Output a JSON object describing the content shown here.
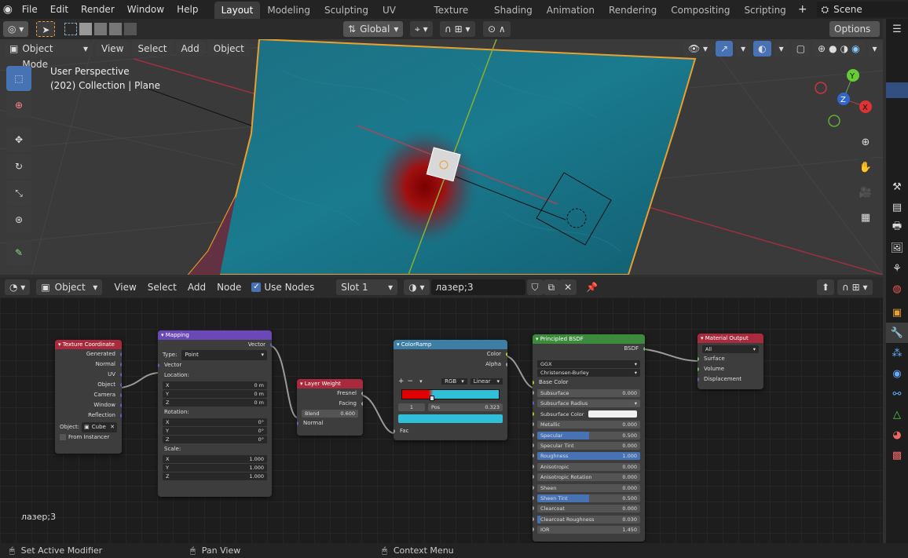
{
  "menubar": {
    "items": [
      "File",
      "Edit",
      "Render",
      "Window",
      "Help"
    ],
    "tabs": [
      "Layout",
      "Modeling",
      "Sculpting",
      "UV Editing",
      "Texture Paint",
      "Shading",
      "Animation",
      "Rendering",
      "Compositing",
      "Scripting"
    ],
    "active_tab": "Layout",
    "scene": "Scene"
  },
  "viewport": {
    "transform": "Global",
    "options": "Options",
    "mode": "Object Mode",
    "menus": [
      "View",
      "Select",
      "Add",
      "Object"
    ],
    "overlay_line1": "User Perspective",
    "overlay_line2": "(202) Collection | Plane",
    "gizmo": {
      "x": "X",
      "y": "Y",
      "z": "Z"
    }
  },
  "node_editor": {
    "type": "Object",
    "menus": [
      "View",
      "Select",
      "Add",
      "Node"
    ],
    "use_nodes": "Use Nodes",
    "slot": "Slot 1",
    "material": "лазер;3",
    "corner_label": "лазер;3"
  },
  "nodes": {
    "tex_coord": {
      "title": "Texture Coordinate",
      "outputs": [
        "Generated",
        "Normal",
        "UV",
        "Object",
        "Camera",
        "Window",
        "Reflection"
      ],
      "object_label": "Object:",
      "object_value": "Cube",
      "from_instancer": "From Instancer"
    },
    "mapping": {
      "title": "Mapping",
      "out": "Vector",
      "type_label": "Type:",
      "type_value": "Point",
      "in_vector": "Vector",
      "location": "Location:",
      "loc": [
        [
          "X",
          "0 m"
        ],
        [
          "Y",
          "0 m"
        ],
        [
          "Z",
          "0 m"
        ]
      ],
      "rotation": "Rotation:",
      "rot": [
        [
          "X",
          "0°"
        ],
        [
          "Y",
          "0°"
        ],
        [
          "Z",
          "0°"
        ]
      ],
      "scale": "Scale:",
      "scl": [
        [
          "X",
          "1.000"
        ],
        [
          "Y",
          "1.000"
        ],
        [
          "Z",
          "1.000"
        ]
      ]
    },
    "layer_weight": {
      "title": "Layer Weight",
      "out1": "Fresnel",
      "out2": "Facing",
      "blend_label": "Blend",
      "blend_value": "0.600",
      "normal": "Normal"
    },
    "color_ramp": {
      "title": "ColorRamp",
      "out1": "Color",
      "out2": "Alpha",
      "plus": "+",
      "minus": "−",
      "mode": "RGB",
      "interp": "Linear",
      "index": "1",
      "pos_label": "Pos",
      "pos_value": "0.323",
      "fac": "Fac",
      "stop_color": "#e00000",
      "end_color": "#2fbfd8"
    },
    "bsdf": {
      "title": "Principled BSDF",
      "out": "BSDF",
      "dist": "GGX",
      "sss": "Christensen-Burley",
      "base_color": "Base Color",
      "fields": [
        [
          "Subsurface",
          "0.000",
          0
        ],
        [
          "Subsurface Radius",
          "",
          0
        ],
        [
          "Subsurface Color",
          "",
          0
        ],
        [
          "Metallic",
          "0.000",
          0
        ],
        [
          "Specular",
          "0.500",
          0.5
        ],
        [
          "Specular Tint",
          "0.000",
          0
        ],
        [
          "Roughness",
          "1.000",
          1
        ],
        [
          "Anisotropic",
          "0.000",
          0
        ],
        [
          "Anisotropic Rotation",
          "0.000",
          0
        ],
        [
          "Sheen",
          "0.000",
          0
        ],
        [
          "Sheen Tint",
          "0.500",
          0.5
        ],
        [
          "Clearcoat",
          "0.000",
          0
        ],
        [
          "Clearcoat Roughness",
          "0.030",
          0.03
        ],
        [
          "IOR",
          "1.450",
          0
        ]
      ]
    },
    "output": {
      "title": "Material Output",
      "target": "All",
      "inputs": [
        "Surface",
        "Volume",
        "Displacement"
      ]
    }
  },
  "status": {
    "left": "Set Active Modifier",
    "mid": "Pan View",
    "right": "Context Menu"
  }
}
